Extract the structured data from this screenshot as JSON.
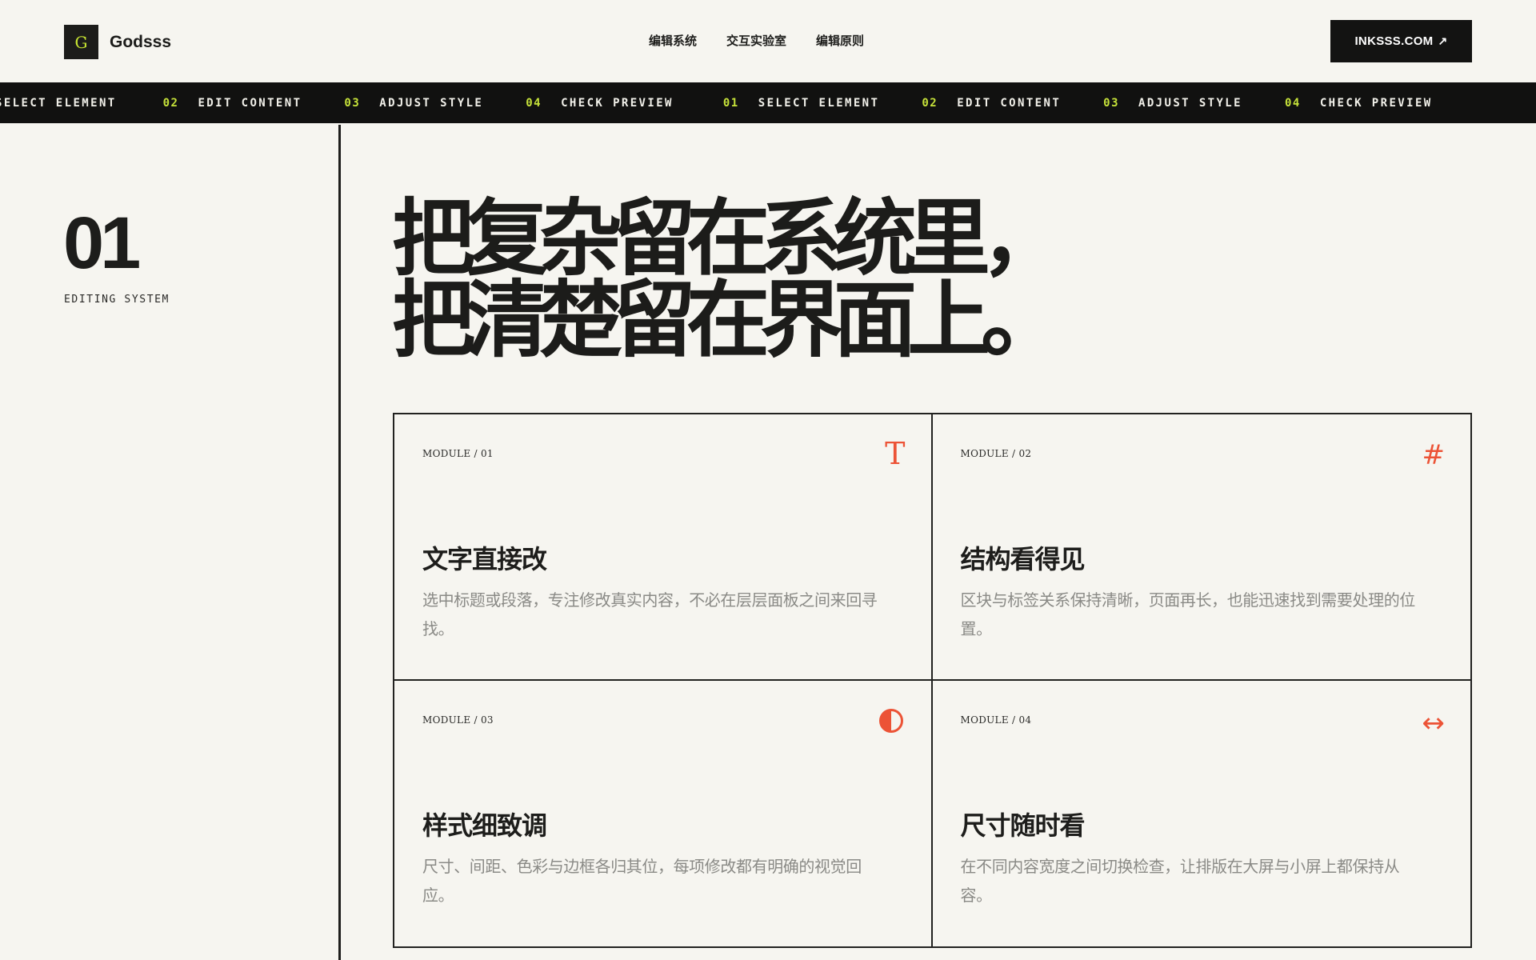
{
  "brand": {
    "logo_letter": "G",
    "name": "Godsss"
  },
  "nav": {
    "items": [
      "编辑系统",
      "交互实验室",
      "编辑原则"
    ]
  },
  "cta": {
    "label": "INKSSS.COM",
    "icon": "arrow-up-right-icon",
    "arrow": "↗"
  },
  "ticker": {
    "items": [
      {
        "num": "",
        "label": "SELECT ELEMENT"
      },
      {
        "num": "02",
        "label": "EDIT CONTENT"
      },
      {
        "num": "03",
        "label": "ADJUST STYLE"
      },
      {
        "num": "04",
        "label": "CHECK PREVIEW"
      },
      {
        "num": "01",
        "label": "SELECT ELEMENT"
      },
      {
        "num": "02",
        "label": "EDIT CONTENT"
      },
      {
        "num": "03",
        "label": "ADJUST STYLE"
      },
      {
        "num": "04",
        "label": "CHECK PREVIEW"
      }
    ]
  },
  "section": {
    "number": "01",
    "label": "EDITING SYSTEM"
  },
  "headline": {
    "line1": "把复杂留在系统里，",
    "line2": "把清楚留在界面上。"
  },
  "modules": [
    {
      "tag": "MODULE / 01",
      "icon": "text-icon",
      "glyph": "T",
      "title": "文字直接改",
      "desc": "选中标题或段落，专注修改真实内容，不必在层层面板之间来回寻找。"
    },
    {
      "tag": "MODULE / 02",
      "icon": "hash-icon",
      "glyph": "#",
      "title": "结构看得见",
      "desc": "区块与标签关系保持清晰，页面再长，也能迅速找到需要处理的位置。"
    },
    {
      "tag": "MODULE / 03",
      "icon": "contrast-icon",
      "glyph": "",
      "title": "样式细致调",
      "desc": "尺寸、间距、色彩与边框各归其位，每项修改都有明确的视觉回应。"
    },
    {
      "tag": "MODULE / 04",
      "icon": "resize-horizontal-icon",
      "glyph": "↔",
      "title": "尺寸随时看",
      "desc": "在不同内容宽度之间切换检查，让排版在大屏与小屏上都保持从容。"
    }
  ],
  "colors": {
    "accent": "#ec5336",
    "lime": "#c6e23a",
    "ink": "#1c1c1a",
    "paper": "#f6f5f0"
  }
}
